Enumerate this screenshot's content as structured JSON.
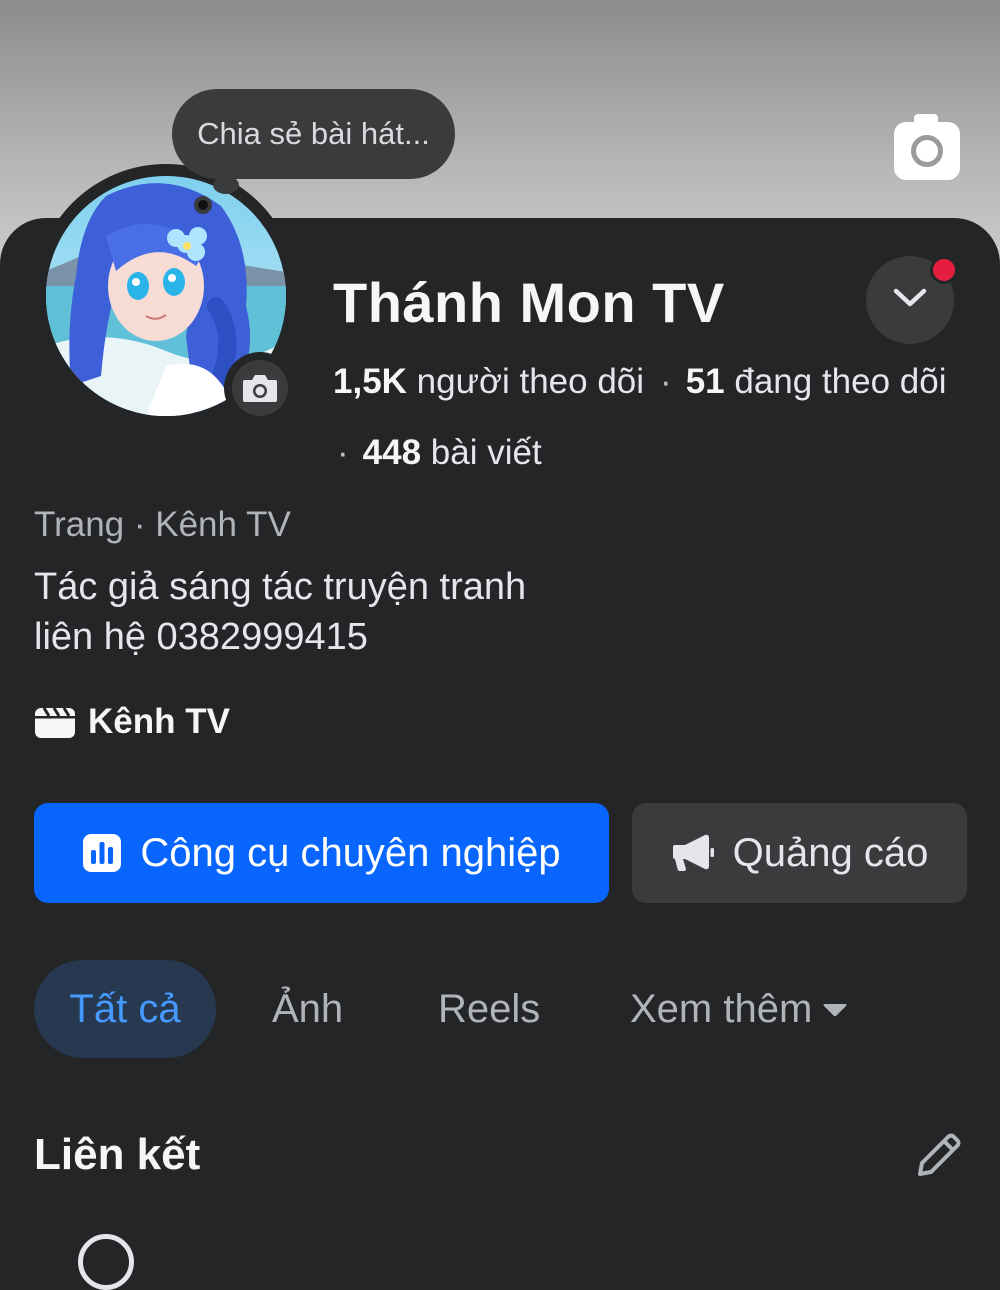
{
  "profile": {
    "name": "Thánh Mon TV",
    "status_prompt": "Chia sẻ bài hát...",
    "followers_count": "1,5K",
    "followers_label": "người theo dõi",
    "following_count": "51",
    "following_label": "đang theo dõi",
    "posts_count": "448",
    "posts_label": "bài viết",
    "category": "Trang · Kênh TV",
    "bio_line1": "Tác giả sáng tác truyện tranh",
    "bio_line2": "liên hệ 0382999415",
    "channel_label": "Kênh TV"
  },
  "actions": {
    "professional_tools": "Công cụ chuyên nghiệp",
    "ads": "Quảng cáo"
  },
  "tabs": {
    "all": "Tất cả",
    "photos": "Ảnh",
    "reels": "Reels",
    "more": "Xem thêm"
  },
  "links_section": {
    "title": "Liên kết"
  },
  "colors": {
    "background": "#242526",
    "primary_button": "#0866ff",
    "secondary_button": "#3a3b3c",
    "active_tab_bg": "#263951",
    "active_tab_text": "#4599ff",
    "notification_dot": "#e41e3f"
  },
  "icons": {
    "cover_camera": "camera-icon",
    "avatar_camera": "camera-icon",
    "dropdown": "chevron-down-icon",
    "channel": "clapperboard-icon",
    "professional_tools": "bar-chart-icon",
    "ads": "megaphone-icon",
    "more_caret": "caret-down-icon",
    "edit": "pencil-icon"
  }
}
